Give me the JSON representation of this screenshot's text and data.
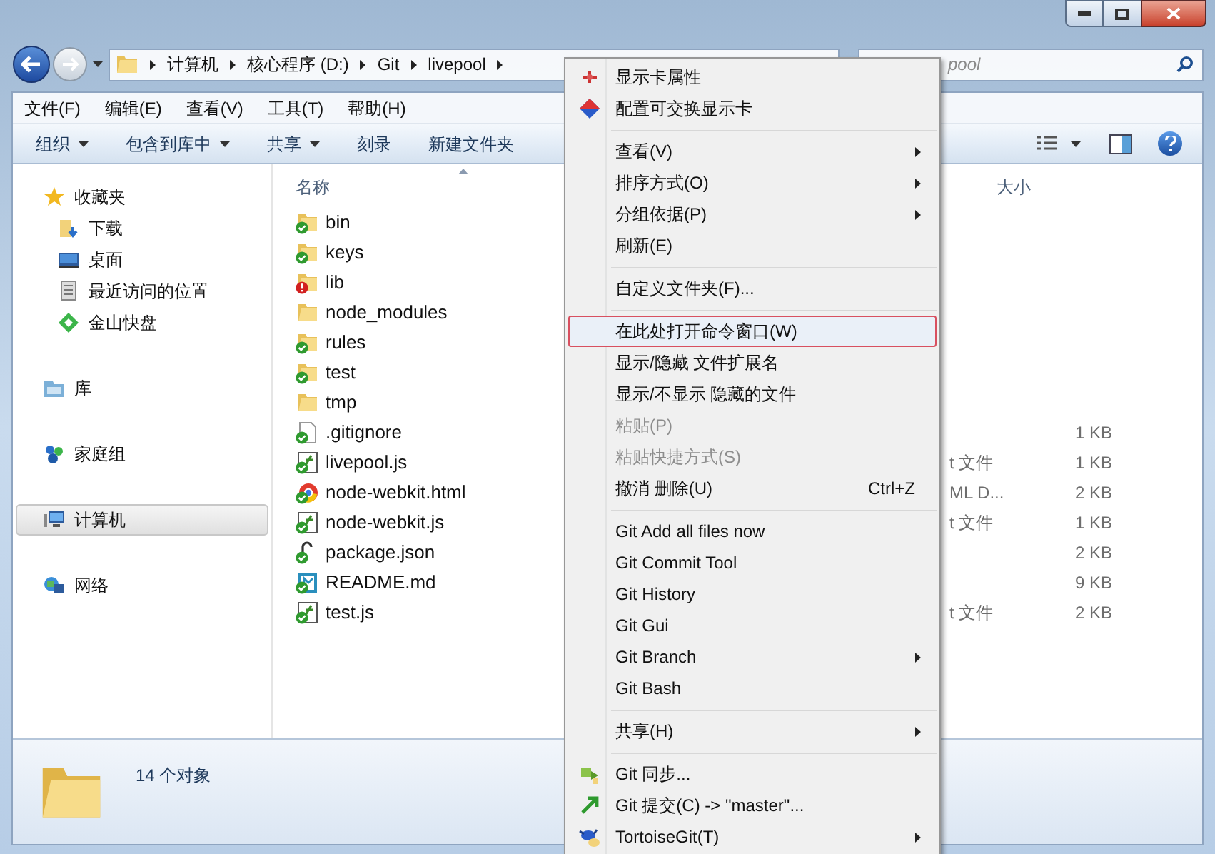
{
  "address_bar": {
    "crumbs": [
      "计算机",
      "核心程序 (D:)",
      "Git",
      "livepool"
    ]
  },
  "search": {
    "placeholder": "pool"
  },
  "menu_bar": [
    "文件(F)",
    "编辑(E)",
    "查看(V)",
    "工具(T)",
    "帮助(H)"
  ],
  "toolbar": [
    {
      "label": "组织",
      "dropdown": true
    },
    {
      "label": "包含到库中",
      "dropdown": true
    },
    {
      "label": "共享",
      "dropdown": true
    },
    {
      "label": "刻录",
      "dropdown": false
    },
    {
      "label": "新建文件夹",
      "dropdown": false
    }
  ],
  "sidebar": {
    "items": [
      {
        "label": "收藏夹",
        "selected": false,
        "children": [
          {
            "label": "下载",
            "selected": false
          },
          {
            "label": "桌面",
            "selected": false
          },
          {
            "label": "最近访问的位置",
            "selected": false
          },
          {
            "label": "金山快盘",
            "selected": false
          }
        ]
      },
      {
        "label": "库",
        "selected": false
      },
      {
        "label": "家庭组",
        "selected": false
      },
      {
        "label": "计算机",
        "selected": true
      },
      {
        "label": "网络",
        "selected": false
      }
    ]
  },
  "table": {
    "columns": [
      "名称",
      "大小"
    ],
    "rows": [
      {
        "name": "bin",
        "kind": "folder",
        "tracked": true,
        "conflict": false
      },
      {
        "name": "keys",
        "kind": "folder",
        "tracked": true,
        "conflict": false
      },
      {
        "name": "lib",
        "kind": "folder",
        "tracked": false,
        "conflict": true
      },
      {
        "name": "node_modules",
        "kind": "folder",
        "tracked": false,
        "conflict": false
      },
      {
        "name": "rules",
        "kind": "folder",
        "tracked": true,
        "conflict": false
      },
      {
        "name": "test",
        "kind": "folder",
        "tracked": true,
        "conflict": false
      },
      {
        "name": "tmp",
        "kind": "folder",
        "tracked": false,
        "conflict": false
      },
      {
        "name": ".gitignore",
        "kind": "text",
        "tracked": true,
        "conflict": false,
        "size": "1 KB"
      },
      {
        "name": "livepool.js",
        "kind": "script",
        "tracked": true,
        "conflict": false,
        "type": "t 文件",
        "size": "1 KB"
      },
      {
        "name": "node-webkit.html",
        "kind": "html",
        "tracked": true,
        "conflict": false,
        "type": "ML D...",
        "size": "2 KB"
      },
      {
        "name": "node-webkit.js",
        "kind": "script",
        "tracked": true,
        "conflict": false,
        "type": "t 文件",
        "size": "1 KB"
      },
      {
        "name": "package.json",
        "kind": "json",
        "tracked": true,
        "conflict": false,
        "size": "2 KB"
      },
      {
        "name": "README.md",
        "kind": "markdown",
        "tracked": true,
        "conflict": false,
        "size": "9 KB"
      },
      {
        "name": "test.js",
        "kind": "script",
        "tracked": true,
        "conflict": false,
        "type": "t 文件",
        "size": "2 KB"
      }
    ]
  },
  "details_pane": {
    "count": "14 个对象"
  },
  "context_menu": {
    "items": [
      {
        "kind": "icon-item",
        "label": "显示卡属性",
        "selected": false,
        "disabled": false,
        "submenu": false
      },
      {
        "kind": "icon-item",
        "label": "配置可交换显示卡",
        "selected": false,
        "disabled": false,
        "submenu": false
      },
      {
        "kind": "separator"
      },
      {
        "kind": "item",
        "label": "查看(V)",
        "selected": false,
        "disabled": false,
        "submenu": true
      },
      {
        "kind": "item",
        "label": "排序方式(O)",
        "selected": false,
        "disabled": false,
        "submenu": true
      },
      {
        "kind": "item",
        "label": "分组依据(P)",
        "selected": false,
        "disabled": false,
        "submenu": true
      },
      {
        "kind": "item",
        "label": "刷新(E)",
        "selected": false,
        "disabled": false,
        "submenu": false
      },
      {
        "kind": "separator"
      },
      {
        "kind": "item",
        "label": "自定义文件夹(F)...",
        "selected": false,
        "disabled": false,
        "submenu": false
      },
      {
        "kind": "separator"
      },
      {
        "kind": "item",
        "label": "在此处打开命令窗口(W)",
        "selected": true,
        "disabled": false,
        "submenu": false
      },
      {
        "kind": "item",
        "label": "显示/隐藏 文件扩展名",
        "selected": false,
        "disabled": false,
        "submenu": false
      },
      {
        "kind": "item",
        "label": "显示/不显示 隐藏的文件",
        "selected": false,
        "disabled": false,
        "submenu": false
      },
      {
        "kind": "item",
        "label": "粘贴(P)",
        "selected": false,
        "disabled": true,
        "submenu": false
      },
      {
        "kind": "item",
        "label": "粘贴快捷方式(S)",
        "selected": false,
        "disabled": true,
        "submenu": false
      },
      {
        "kind": "item",
        "label": "撤消 删除(U)",
        "shortcut": "Ctrl+Z",
        "selected": false,
        "disabled": false,
        "submenu": false
      },
      {
        "kind": "separator"
      },
      {
        "kind": "item",
        "label": "Git Add all files now",
        "selected": false,
        "disabled": false,
        "submenu": false
      },
      {
        "kind": "item",
        "label": "Git Commit Tool",
        "selected": false,
        "disabled": false,
        "submenu": false
      },
      {
        "kind": "item",
        "label": "Git History",
        "selected": false,
        "disabled": false,
        "submenu": false
      },
      {
        "kind": "item",
        "label": "Git Gui",
        "selected": false,
        "disabled": false,
        "submenu": false
      },
      {
        "kind": "item",
        "label": "Git Branch",
        "selected": false,
        "disabled": false,
        "submenu": true
      },
      {
        "kind": "item",
        "label": "Git Bash",
        "selected": false,
        "disabled": false,
        "submenu": false
      },
      {
        "kind": "separator"
      },
      {
        "kind": "item",
        "label": "共享(H)",
        "selected": false,
        "disabled": false,
        "submenu": true
      },
      {
        "kind": "separator"
      },
      {
        "kind": "icon-item",
        "label": "Git 同步...",
        "selected": false,
        "disabled": false,
        "submenu": false
      },
      {
        "kind": "icon-item",
        "label": "Git 提交(C) -> \"master\"...",
        "selected": false,
        "disabled": false,
        "submenu": false
      },
      {
        "kind": "icon-item",
        "label": "TortoiseGit(T)",
        "selected": false,
        "disabled": false,
        "submenu": true
      }
    ]
  }
}
